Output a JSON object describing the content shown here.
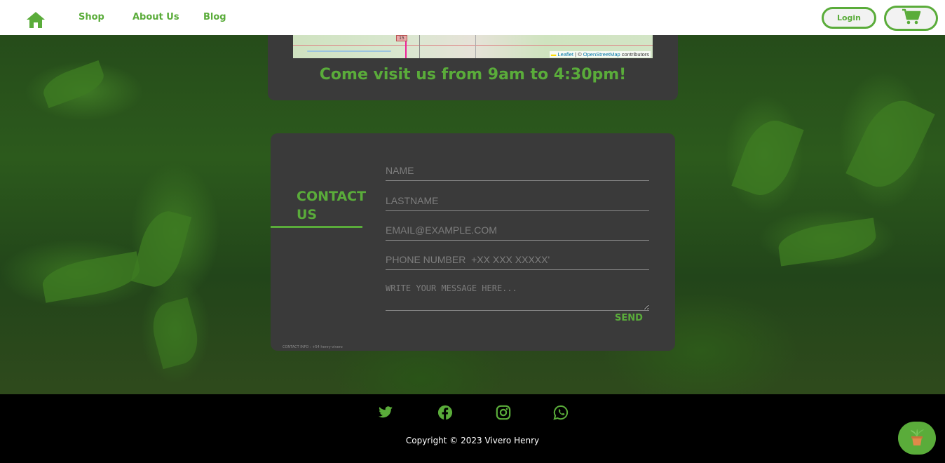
{
  "navbar": {
    "home_icon": "home-icon",
    "links": [
      "Shop",
      "About Us",
      "Blog"
    ],
    "login_label": "Login",
    "cart_icon": "cart-icon"
  },
  "map_section": {
    "attribution_leaflet": "Leaflet",
    "attribution_sep": " | © ",
    "attribution_osm": "OpenStreetMap",
    "attribution_tail": " contributors",
    "road_shield": "15",
    "visit_text": "Come visit us from 9am to 4:30pm!"
  },
  "contact": {
    "title": "CONTACT US",
    "fields": {
      "name_placeholder": "NAME",
      "lastname_placeholder": "LASTNAME",
      "email_placeholder": "EMAIL@EXAMPLE.COM",
      "phone_placeholder": "PHONE NUMBER  +XX XXX XXXXX'",
      "message_placeholder": "WRITE YOUR MESSAGE HERE..."
    },
    "send_label": "SEND",
    "info_text": "CONTACT INFO : +54 henry-vivero"
  },
  "footer": {
    "social_icons": [
      "twitter-icon",
      "facebook-icon",
      "instagram-icon",
      "whatsapp-icon"
    ],
    "copyright": "Copyright © 2023 Vivero Henry"
  },
  "colors": {
    "accent": "#5aac3a",
    "card": "#3a3a3a",
    "footer": "#000000"
  },
  "fab_icon": "potted-plant-icon"
}
